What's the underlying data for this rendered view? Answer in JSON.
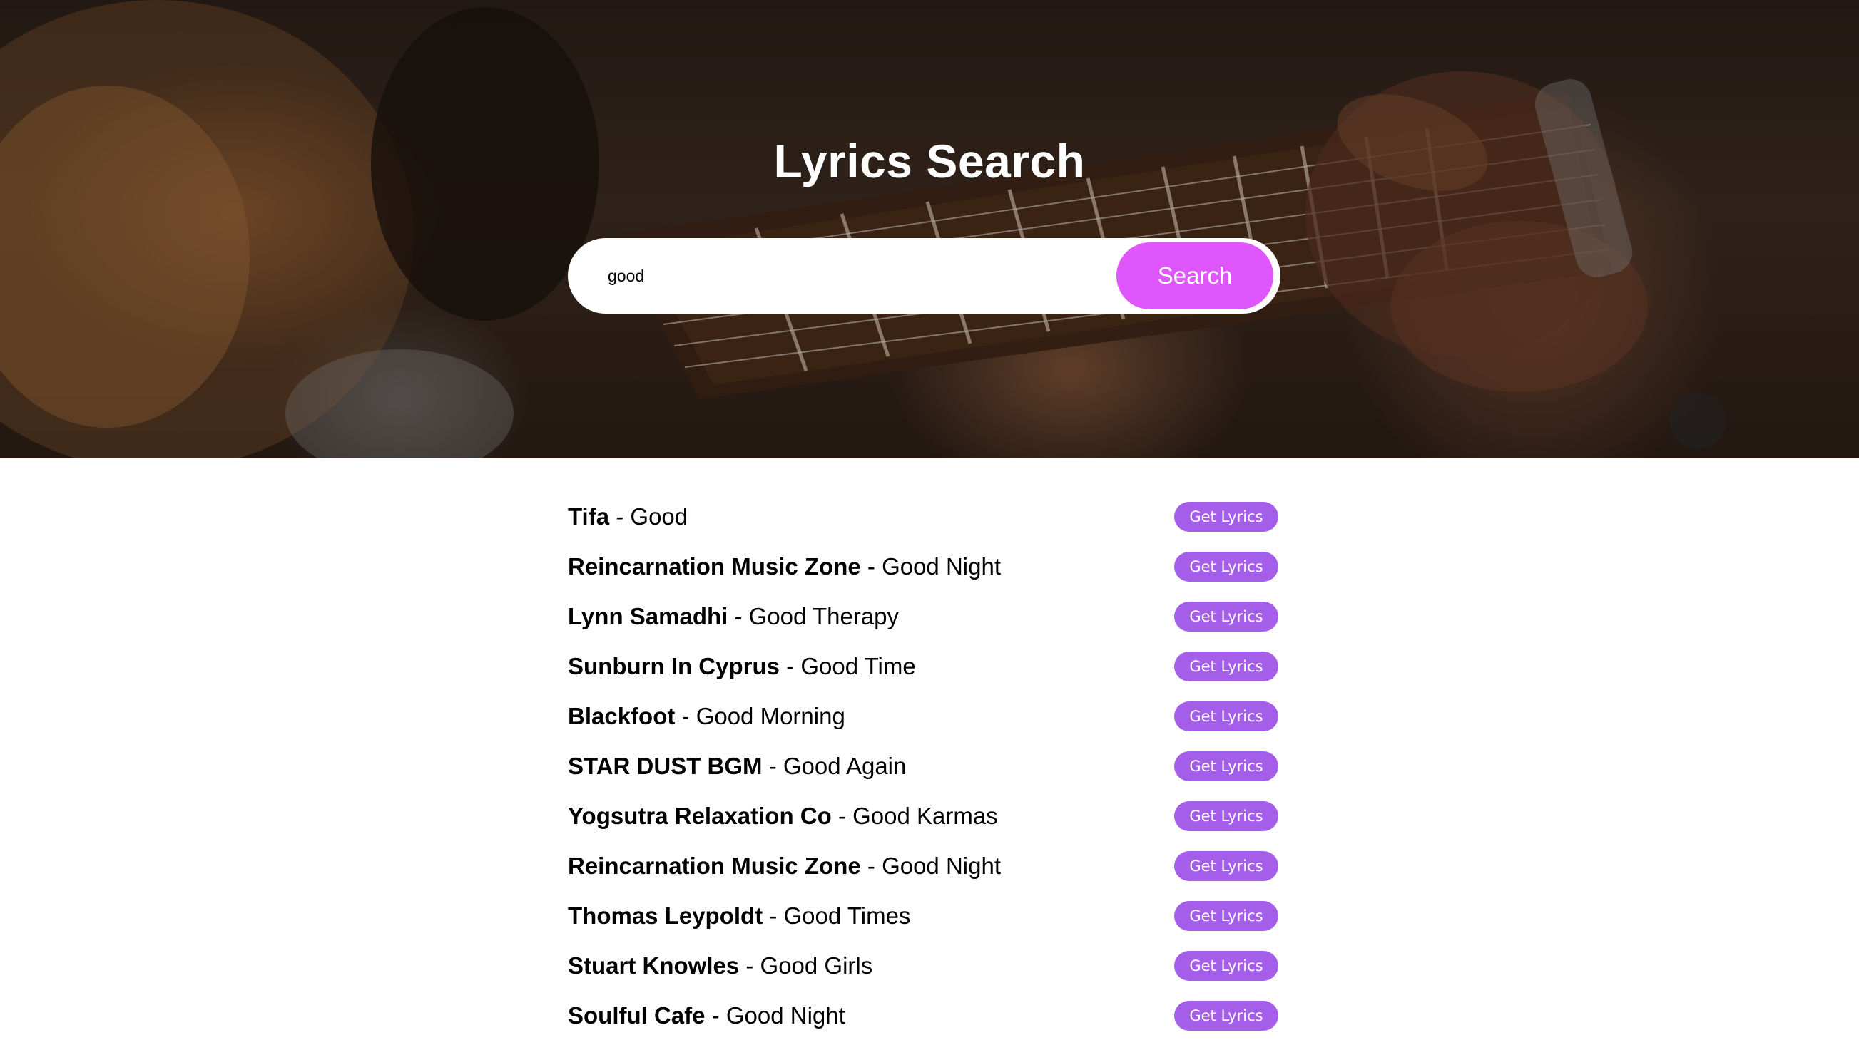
{
  "header": {
    "title": "Lyrics Search"
  },
  "search": {
    "value": "good",
    "placeholder": "",
    "button_label": "Search"
  },
  "results": [
    {
      "artist": "Tifa",
      "separator": " - ",
      "title": "Good",
      "button_label": "Get Lyrics"
    },
    {
      "artist": "Reincarnation Music Zone",
      "separator": " - ",
      "title": "Good Night",
      "button_label": "Get Lyrics"
    },
    {
      "artist": "Lynn Samadhi",
      "separator": " - ",
      "title": "Good Therapy",
      "button_label": "Get Lyrics"
    },
    {
      "artist": "Sunburn In Cyprus",
      "separator": " - ",
      "title": "Good Time",
      "button_label": "Get Lyrics"
    },
    {
      "artist": "Blackfoot",
      "separator": " - ",
      "title": "Good Morning",
      "button_label": "Get Lyrics"
    },
    {
      "artist": "STAR DUST BGM",
      "separator": " - ",
      "title": "Good Again",
      "button_label": "Get Lyrics"
    },
    {
      "artist": "Yogsutra Relaxation Co",
      "separator": " - ",
      "title": "Good Karmas",
      "button_label": "Get Lyrics"
    },
    {
      "artist": "Reincarnation Music Zone",
      "separator": " - ",
      "title": "Good Night",
      "button_label": "Get Lyrics"
    },
    {
      "artist": "Thomas Leypoldt",
      "separator": " - ",
      "title": "Good Times",
      "button_label": "Get Lyrics"
    },
    {
      "artist": "Stuart Knowles",
      "separator": " - ",
      "title": "Good Girls",
      "button_label": "Get Lyrics"
    },
    {
      "artist": "Soulful Cafe",
      "separator": " - ",
      "title": "Good Night",
      "button_label": "Get Lyrics"
    }
  ],
  "colors": {
    "search_button": "#e056fd",
    "get_lyrics_button": "#a55eea",
    "hero_text": "#ffffff"
  }
}
